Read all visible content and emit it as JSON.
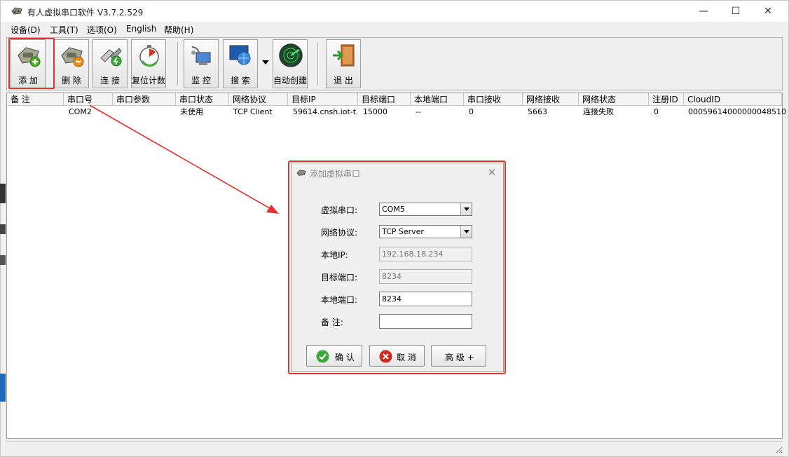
{
  "window": {
    "title": "有人虚拟串口软件 V3.7.2.529",
    "controls": {
      "minimize": "—",
      "maximize": "☐",
      "close": "✕"
    }
  },
  "menu": [
    {
      "label": "设备(D)"
    },
    {
      "label": "工具(T)"
    },
    {
      "label": "选项(O)"
    },
    {
      "label": "English"
    },
    {
      "label": "帮助(H)"
    }
  ],
  "toolbar": {
    "add": "添 加",
    "delete": "删 除",
    "connect": "连 接",
    "reset_count": "复位计数",
    "monitor": "监 控",
    "search": "搜 索",
    "auto_create": "自动创建",
    "exit": "退 出"
  },
  "table": {
    "columns": [
      "备 注",
      "串口号",
      "串口参数",
      "串口状态",
      "网络协议",
      "目标IP",
      "目标端口",
      "本地端口",
      "串口接收",
      "网络接收",
      "网络状态",
      "注册ID",
      "CloudID"
    ],
    "rows": [
      {
        "note": "",
        "port": "COM2",
        "params": "",
        "port_status": "未使用",
        "protocol": "TCP Client",
        "target_ip": "59614.cnsh.iot-t...",
        "target_port": "15000",
        "local_port": "--",
        "serial_rx": "0",
        "net_rx": "5663",
        "net_status": "连接失败",
        "reg_id": "0",
        "cloud_id": "00059614000000048510"
      }
    ]
  },
  "dialog": {
    "title": "添加虚拟串口",
    "close": "✕",
    "virtual_port": {
      "label": "虚拟串口:",
      "value": "COM5"
    },
    "protocol": {
      "label": "网络协议:",
      "value": "TCP Server"
    },
    "local_ip": {
      "label": "本地IP:",
      "value": "192.168.18.234"
    },
    "target_port": {
      "label": "目标端口:",
      "value": "8234"
    },
    "local_port": {
      "label": "本地端口:",
      "value": "8234"
    },
    "note": {
      "label": "备  注:",
      "value": ""
    },
    "ok": "确 认",
    "cancel": "取 消",
    "advanced": "高 级 +"
  },
  "colors": {
    "highlight": "#e53030",
    "ok_icon": "#3aa83a",
    "cancel_icon": "#cc2a1e"
  }
}
